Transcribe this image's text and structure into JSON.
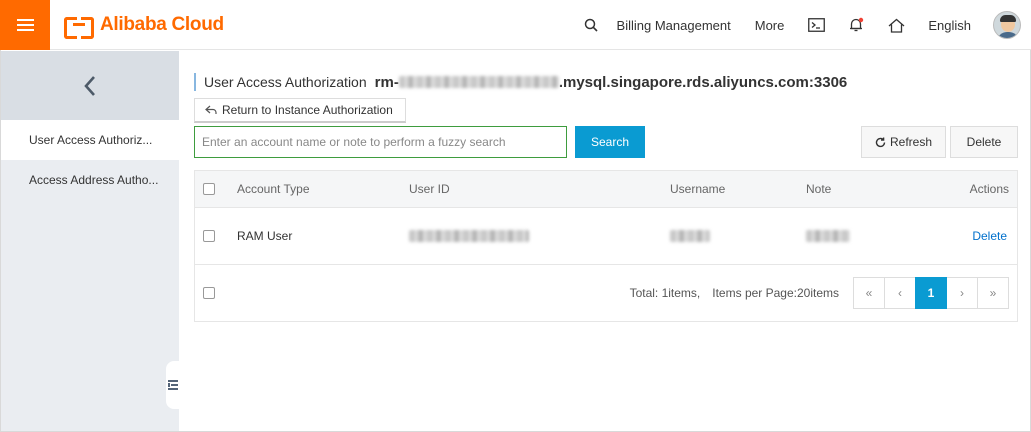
{
  "colors": {
    "brand": "#ff6a00",
    "primary": "#0a9bd2",
    "link": "#0070cc"
  },
  "header": {
    "brand": "Alibaba Cloud",
    "nav": {
      "billing": "Billing Management",
      "more": "More",
      "language": "English"
    },
    "icons": [
      "search-icon",
      "terminal-icon",
      "bell-icon",
      "home-icon"
    ]
  },
  "sidebar": {
    "items": [
      {
        "label": "User Access Authoriz..."
      },
      {
        "label": "Access Address Autho..."
      }
    ]
  },
  "main": {
    "title_label": "User Access Authorization",
    "instance_prefix": "rm-",
    "instance_suffix": ".mysql.singapore.rds.aliyuncs.com:3306",
    "return_label": "Return to Instance Authorization",
    "search_placeholder": "Enter an account name or note to perform a fuzzy search",
    "search_value": "",
    "search_label": "Search",
    "refresh_label": "Refresh",
    "delete_label": "Delete"
  },
  "table": {
    "headers": {
      "type": "Account Type",
      "user_id": "User ID",
      "username": "Username",
      "note": "Note",
      "actions": "Actions"
    },
    "rows": [
      {
        "type": "RAM User",
        "action": "Delete"
      }
    ]
  },
  "footer": {
    "total": "Total: 1items,",
    "per_page": "Items per Page:20items",
    "pages": {
      "first": "«",
      "prev": "‹",
      "current": "1",
      "next": "›",
      "last": "»"
    }
  }
}
